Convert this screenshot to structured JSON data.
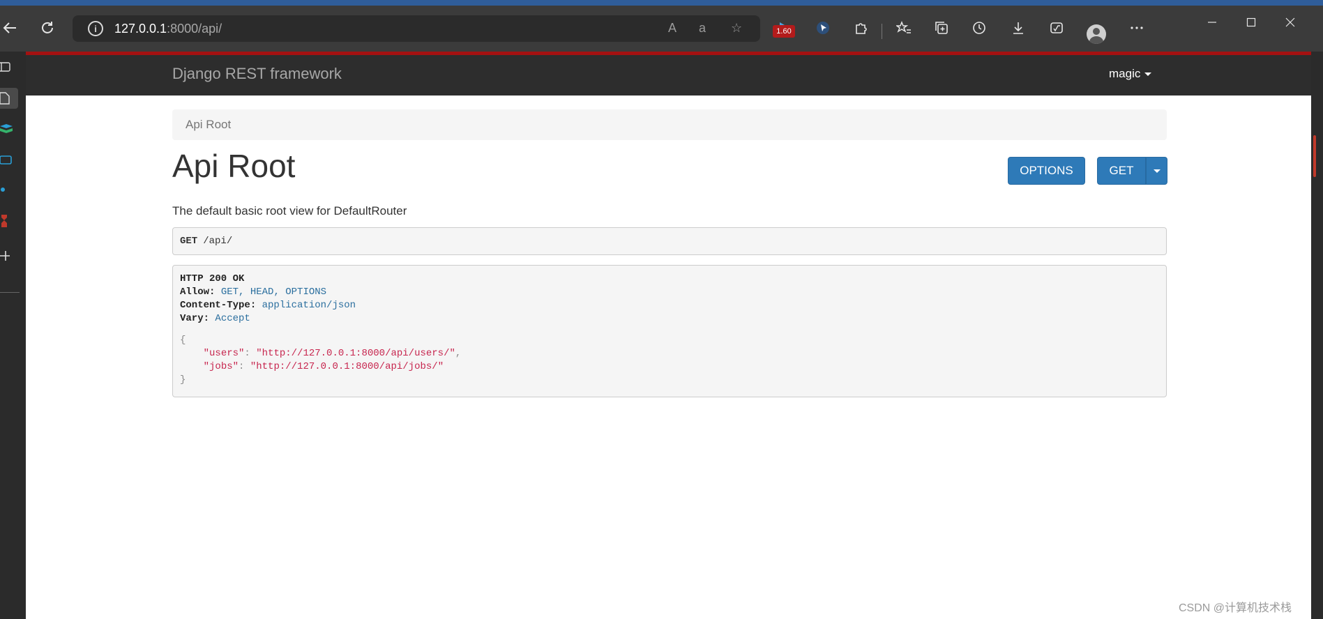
{
  "browser": {
    "url_host": "127.0.0.1",
    "url_path": ":8000/api/",
    "extension_badge": "1.60"
  },
  "navbar": {
    "brand": "Django REST framework",
    "user": "magic"
  },
  "breadcrumb": {
    "current": "Api Root"
  },
  "main": {
    "title": "Api Root",
    "description": "The default basic root view for DefaultRouter",
    "buttons": {
      "options": "OPTIONS",
      "get": "GET"
    },
    "request": {
      "method": "GET",
      "path": "/api/"
    },
    "response": {
      "status": "HTTP 200 OK",
      "headers": [
        {
          "key": "Allow:",
          "value": "GET, HEAD, OPTIONS"
        },
        {
          "key": "Content-Type:",
          "value": "application/json"
        },
        {
          "key": "Vary:",
          "value": "Accept"
        }
      ],
      "body_open": "{",
      "body": [
        {
          "key": "\"users\"",
          "value": "\"http://127.0.0.1:8000/api/users/\"",
          "trail": ","
        },
        {
          "key": "\"jobs\"",
          "value": "\"http://127.0.0.1:8000/api/jobs/\"",
          "trail": ""
        }
      ],
      "body_close": "}"
    }
  },
  "watermark": "CSDN @计算机技术栈"
}
